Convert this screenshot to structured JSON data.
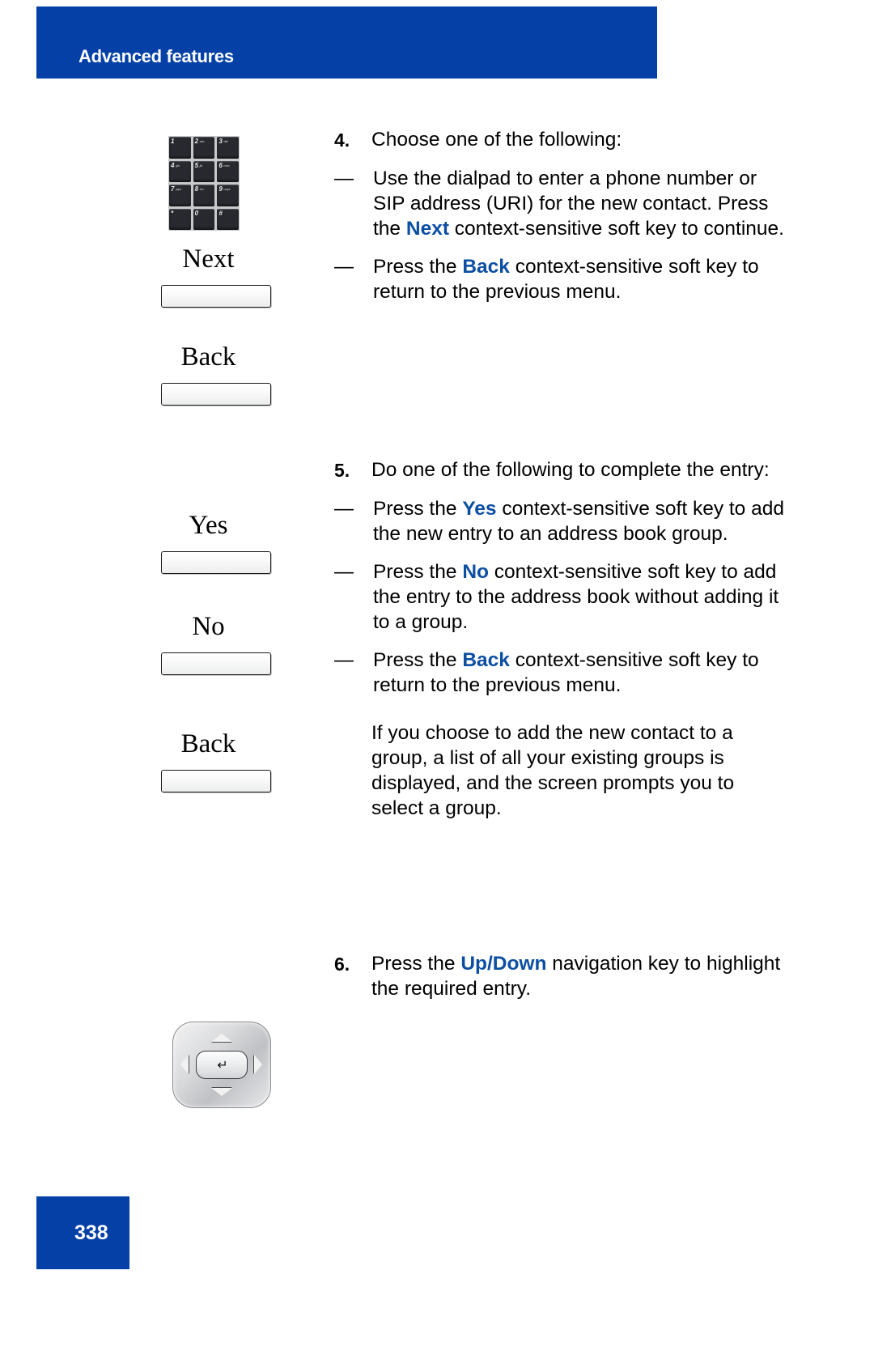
{
  "header": {
    "title": "Advanced features",
    "banner_color": "#0540a6"
  },
  "footer": {
    "page_number": "338",
    "box_color": "#0540a6"
  },
  "accent_color": "#0b4ea2",
  "left_column": {
    "dialpad": {
      "name": "dialpad-graphic",
      "keys": [
        {
          "num": "1",
          "letters": ""
        },
        {
          "num": "2",
          "letters": "abc"
        },
        {
          "num": "3",
          "letters": "def"
        },
        {
          "num": "4",
          "letters": "ghi"
        },
        {
          "num": "5",
          "letters": "jkl"
        },
        {
          "num": "6",
          "letters": "mno"
        },
        {
          "num": "7",
          "letters": "pqrs"
        },
        {
          "num": "8",
          "letters": "tuv"
        },
        {
          "num": "9",
          "letters": "wxyz"
        },
        {
          "num": "*",
          "letters": ""
        },
        {
          "num": "0",
          "letters": ""
        },
        {
          "num": "#",
          "letters": ""
        }
      ]
    },
    "softkeys": [
      {
        "label": "Next"
      },
      {
        "label": "Back"
      },
      {
        "label": "Yes"
      },
      {
        "label": "No"
      },
      {
        "label": "Back"
      }
    ],
    "navigation_key": {
      "name": "navigation-key-graphic",
      "up": "up-arrow",
      "down": "down-arrow",
      "left": "left-arrow",
      "right": "right-arrow",
      "center": "enter-key",
      "center_glyph": "↵"
    }
  },
  "steps": [
    {
      "number": "4.",
      "text": "Choose one of the following:",
      "bullets": [
        {
          "dash": "—",
          "segments": [
            {
              "text": "Use the dialpad to enter a phone number or SIP address (URI) for the new contact. Press the ",
              "style": "normal"
            },
            {
              "text": "Next",
              "style": "blue"
            },
            {
              "text": " context-sensitive soft key to continue.",
              "style": "normal"
            }
          ]
        },
        {
          "dash": "—",
          "segments": [
            {
              "text": "Press the ",
              "style": "normal"
            },
            {
              "text": "Back",
              "style": "blue"
            },
            {
              "text": " context-sensitive soft key to return to the previous menu.",
              "style": "normal"
            }
          ]
        }
      ]
    },
    {
      "number": "5.",
      "text": "Do one of the following to complete the entry:",
      "bullets": [
        {
          "dash": "—",
          "segments": [
            {
              "text": "Press the ",
              "style": "normal"
            },
            {
              "text": "Yes",
              "style": "blue"
            },
            {
              "text": " context-sensitive soft key to add the new entry to an address book group.",
              "style": "normal"
            }
          ]
        },
        {
          "dash": "—",
          "segments": [
            {
              "text": "Press the ",
              "style": "normal"
            },
            {
              "text": "No",
              "style": "blue"
            },
            {
              "text": " context-sensitive soft key to add the entry to the address book without adding it to a group.",
              "style": "normal"
            }
          ]
        },
        {
          "dash": "—",
          "segments": [
            {
              "text": "Press the ",
              "style": "normal"
            },
            {
              "text": "Back",
              "style": "blue"
            },
            {
              "text": " context-sensitive soft key to return to the previous menu.",
              "style": "normal"
            }
          ]
        }
      ],
      "trailing_paragraph": "If you choose to add the new contact to a group, a list of all your existing groups is displayed, and the screen prompts you to select a group."
    },
    {
      "number": "6.",
      "text_segments": [
        {
          "text": "Press the ",
          "style": "normal"
        },
        {
          "text": "Up/Down",
          "style": "blue"
        },
        {
          "text": " navigation key to highlight the required entry.",
          "style": "normal"
        }
      ]
    }
  ]
}
